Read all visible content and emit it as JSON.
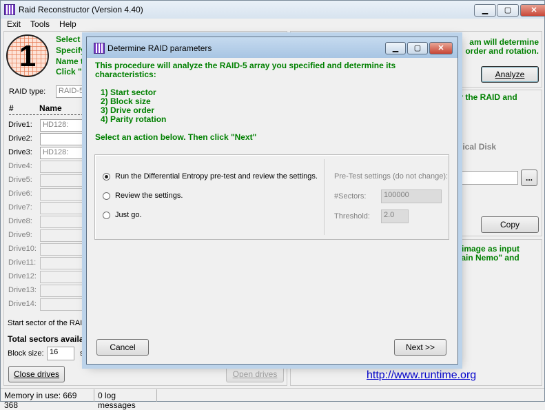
{
  "window": {
    "title": "Raid Reconstructor (Version 4.40)",
    "minimize": "▁",
    "maximize": "▢",
    "close": "✕"
  },
  "menu": [
    "Exit",
    "Tools",
    "Help"
  ],
  "step_panel": {
    "step_number": "1",
    "lines": [
      "Select th",
      "Specify",
      "Name th",
      "Click \"O"
    ]
  },
  "raid_type": {
    "label": "RAID type:",
    "value": "RAID-5"
  },
  "drives_table": {
    "col_number": "#",
    "col_name": "Name",
    "rows": [
      {
        "label": "Drive1:",
        "value": "HD128:",
        "active": true
      },
      {
        "label": "Drive2:",
        "value": "",
        "active": true
      },
      {
        "label": "Drive3:",
        "value": "HD128:",
        "active": true
      },
      {
        "label": "Drive4:",
        "value": "",
        "active": false
      },
      {
        "label": "Drive5:",
        "value": "",
        "active": false
      },
      {
        "label": "Drive6:",
        "value": "",
        "active": false
      },
      {
        "label": "Drive7:",
        "value": "",
        "active": false
      },
      {
        "label": "Drive8:",
        "value": "",
        "active": false
      },
      {
        "label": "Drive9:",
        "value": "",
        "active": false
      },
      {
        "label": "Drive10:",
        "value": "",
        "active": false
      },
      {
        "label": "Drive11:",
        "value": "",
        "active": false
      },
      {
        "label": "Drive12:",
        "value": "",
        "active": false
      },
      {
        "label": "Drive13:",
        "value": "",
        "active": false
      },
      {
        "label": "Drive14:",
        "value": "",
        "active": false
      }
    ]
  },
  "start_sector_label": "Start sector of the RAID",
  "total_sectors_label": "Total sectors availal",
  "block_size": {
    "label": "Block size:",
    "value": "16",
    "suffix": "se"
  },
  "buttons": {
    "close_drives": "Close drives",
    "open_drives": "Open drives",
    "analyze": "Analyze",
    "copy": "Copy",
    "browse": "..."
  },
  "right_panel": {
    "text1_lines": [
      "am will determine",
      "order and rotation."
    ],
    "text2_lines": [
      "py the RAID and"
    ],
    "physical_disk_label": "ysical Disk",
    "text3_lines": [
      "D image as input",
      "ptain Nemo\" and"
    ],
    "link": "http://www.runtime.org"
  },
  "status_bar": {
    "memory": "Memory in use: 669 368",
    "log": "0 log messages"
  },
  "dialog": {
    "title": "Determine RAID parameters",
    "intro_lines": [
      "This procedure will analyze the RAID-5 array you specified and determine its",
      "characteristics:"
    ],
    "steps": [
      "1) Start sector",
      "2) Block size",
      "3) Drive order",
      "4) Parity rotation"
    ],
    "select_action": "Select an action below. Then click \"Next\"",
    "options": [
      {
        "label": "Run the Differential Entropy pre-test and review the settings.",
        "checked": true
      },
      {
        "label": "Review the settings.",
        "checked": false
      },
      {
        "label": "Just go.",
        "checked": false
      }
    ],
    "pretest": {
      "title": "Pre-Test settings (do not change):",
      "sectors_label": "#Sectors:",
      "sectors_value": "100000",
      "threshold_label": "Threshold:",
      "threshold_value": "2.0"
    },
    "cancel": "Cancel",
    "next": "Next >>"
  }
}
